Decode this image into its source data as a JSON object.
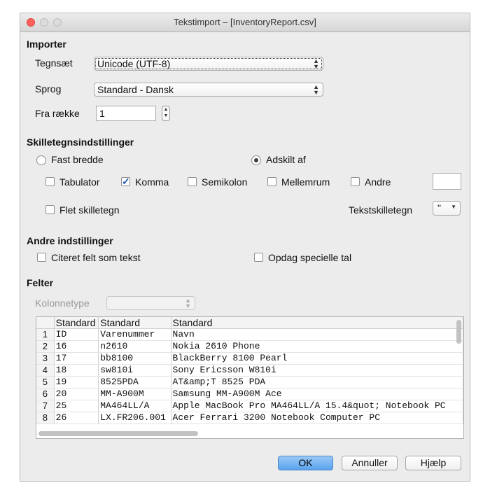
{
  "window": {
    "title": "Tekstimport – [InventoryReport.csv]"
  },
  "import": {
    "heading": "Importer",
    "charset_label": "Tegnsæt",
    "charset_value": "Unicode (UTF-8)",
    "language_label": "Sprog",
    "language_value": "Standard - Dansk",
    "from_row_label": "Fra række",
    "from_row_value": "1"
  },
  "separators": {
    "heading": "Skilletegnsindstillinger",
    "fixed_width_label": "Fast bredde",
    "fixed_width_selected": false,
    "separated_by_label": "Adskilt af",
    "separated_by_selected": true,
    "tab_label": "Tabulator",
    "tab_checked": false,
    "comma_label": "Komma",
    "comma_checked": true,
    "semicolon_label": "Semikolon",
    "semicolon_checked": false,
    "space_label": "Mellemrum",
    "space_checked": false,
    "other_label": "Andre",
    "other_checked": false,
    "other_value": "",
    "merge_label": "Flet skilletegn",
    "merge_checked": false,
    "text_delimiter_label": "Tekstskilletegn",
    "text_delimiter_value": "\""
  },
  "other_options": {
    "heading": "Andre indstillinger",
    "quoted_as_text_label": "Citeret felt som tekst",
    "quoted_as_text_checked": false,
    "detect_special_numbers_label": "Opdag specielle tal",
    "detect_special_numbers_checked": false
  },
  "fields": {
    "heading": "Felter",
    "column_type_label": "Kolonnetype",
    "column_type_value": "",
    "columns": [
      "Standard",
      "Standard",
      "Standard"
    ],
    "rows": [
      {
        "num": "1",
        "cells": [
          "ID",
          "Varenummer",
          "Navn"
        ]
      },
      {
        "num": "2",
        "cells": [
          "16",
          "n2610",
          "Nokia 2610 Phone"
        ]
      },
      {
        "num": "3",
        "cells": [
          "17",
          "bb8100",
          "BlackBerry 8100 Pearl"
        ]
      },
      {
        "num": "4",
        "cells": [
          "18",
          "sw810i",
          "Sony Ericsson W810i"
        ]
      },
      {
        "num": "5",
        "cells": [
          "19",
          "8525PDA",
          "AT&amp;T 8525 PDA"
        ]
      },
      {
        "num": "6",
        "cells": [
          "20",
          "MM-A900M",
          "Samsung MM-A900M Ace"
        ]
      },
      {
        "num": "7",
        "cells": [
          "25",
          "MA464LL/A",
          "Apple MacBook Pro MA464LL/A 15.4&quot; Notebook PC"
        ]
      },
      {
        "num": "8",
        "cells": [
          "26",
          "LX.FR206.001",
          "Acer Ferrari 3200 Notebook Computer PC"
        ]
      }
    ]
  },
  "buttons": {
    "ok": "OK",
    "cancel": "Annuller",
    "help": "Hjælp"
  },
  "icons": {
    "select_arrows": "up-down-arrows-icon",
    "stepper": "stepper-icon",
    "checkmark": "checkmark-icon"
  }
}
